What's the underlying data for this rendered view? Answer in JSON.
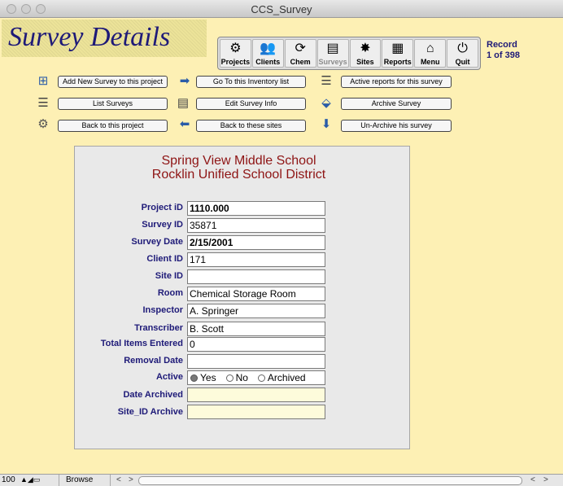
{
  "window": {
    "title": "CCS_Survey"
  },
  "page_title": "Survey Details",
  "navbar": [
    {
      "label": "Projects",
      "icon": "⚙",
      "active": false
    },
    {
      "label": "Clients",
      "icon": "👥",
      "active": false
    },
    {
      "label": "Chem",
      "icon": "⟳",
      "active": false
    },
    {
      "label": "Surveys",
      "icon": "▤",
      "active": true
    },
    {
      "label": "Sites",
      "icon": "✸",
      "active": false
    },
    {
      "label": "Reports",
      "icon": "▦",
      "active": false
    },
    {
      "label": "Menu",
      "icon": "⌂",
      "active": false
    },
    {
      "label": "Quit",
      "icon": "⏻",
      "active": false
    }
  ],
  "record": {
    "label": "Record",
    "position": "1 of 398"
  },
  "actions": {
    "add_new_survey": "Add New Survey to this project",
    "go_to_inventory": "Go To this Inventory list",
    "active_reports": "Active reports for this survey",
    "list_surveys": "List Surveys",
    "edit_survey_info": "Edit Survey Info",
    "archive_survey": "Archive Survey",
    "back_to_project": "Back to this project",
    "back_to_sites": "Back to these sites",
    "unarchive_survey": "Un-Archive his survey"
  },
  "school": {
    "name": "Spring View Middle School",
    "district": "Rocklin Unified School District"
  },
  "fields": {
    "project_id": {
      "label": "Project iD",
      "value": "1110.000"
    },
    "survey_id": {
      "label": "Survey ID",
      "value": "35871"
    },
    "survey_date": {
      "label": "Survey Date",
      "value": "2/15/2001"
    },
    "client_id": {
      "label": "Client ID",
      "value": "171"
    },
    "site_id": {
      "label": "Site ID",
      "value": ""
    },
    "room": {
      "label": "Room",
      "value": "Chemical Storage Room"
    },
    "inspector": {
      "label": "Inspector",
      "value": "A. Springer"
    },
    "transcriber": {
      "label": "Transcriber",
      "value": "B. Scott"
    },
    "total_items": {
      "label": "Total  Items Entered",
      "value": "0"
    },
    "removal_date": {
      "label": "Removal Date",
      "value": ""
    },
    "active": {
      "label": "Active",
      "options": [
        "Yes",
        "No",
        "Archived"
      ],
      "selected": "Yes"
    },
    "date_archived": {
      "label": "Date Archived",
      "value": ""
    },
    "site_id_archive": {
      "label": "Site_ID Archive",
      "value": ""
    }
  },
  "status": {
    "zoom": "100",
    "mode": "Browse"
  }
}
